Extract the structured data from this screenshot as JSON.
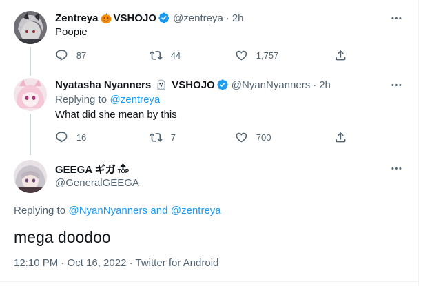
{
  "tweets": [
    {
      "display_name": "Zentreya",
      "org": "VSHOJO",
      "org_emoji": "pumpkin",
      "handle": "@zentreya",
      "separator": "·",
      "time": "2h",
      "text": "Poopie",
      "replies": "87",
      "retweets": "44",
      "likes": "1,757"
    },
    {
      "display_name": "Nyatasha Nyanners",
      "org": "VSHOJO",
      "org_emoji": "ghost",
      "handle": "@NyanNyanners",
      "separator": "·",
      "time": "2h",
      "replying_prefix": "Replying to",
      "replying_to": "@zentreya",
      "text": "What did she mean by this",
      "replies": "16",
      "retweets": "7",
      "likes": "700"
    }
  ],
  "main_tweet": {
    "display_name": "GEEGA ギガ",
    "badge_text": "TOP",
    "handle": "@GeneralGEEGA",
    "replying_prefix": "Replying to",
    "replying_to_1": "@NyanNyanners",
    "replying_and": "and",
    "replying_to_2": "@zentreya",
    "text": "mega doodoo",
    "timestamp": "12:10 PM · Oct 16, 2022 · Twitter for Android"
  },
  "colors": {
    "accent": "#1d9bf0",
    "muted": "#536471",
    "thread_line": "#cfd9de"
  }
}
